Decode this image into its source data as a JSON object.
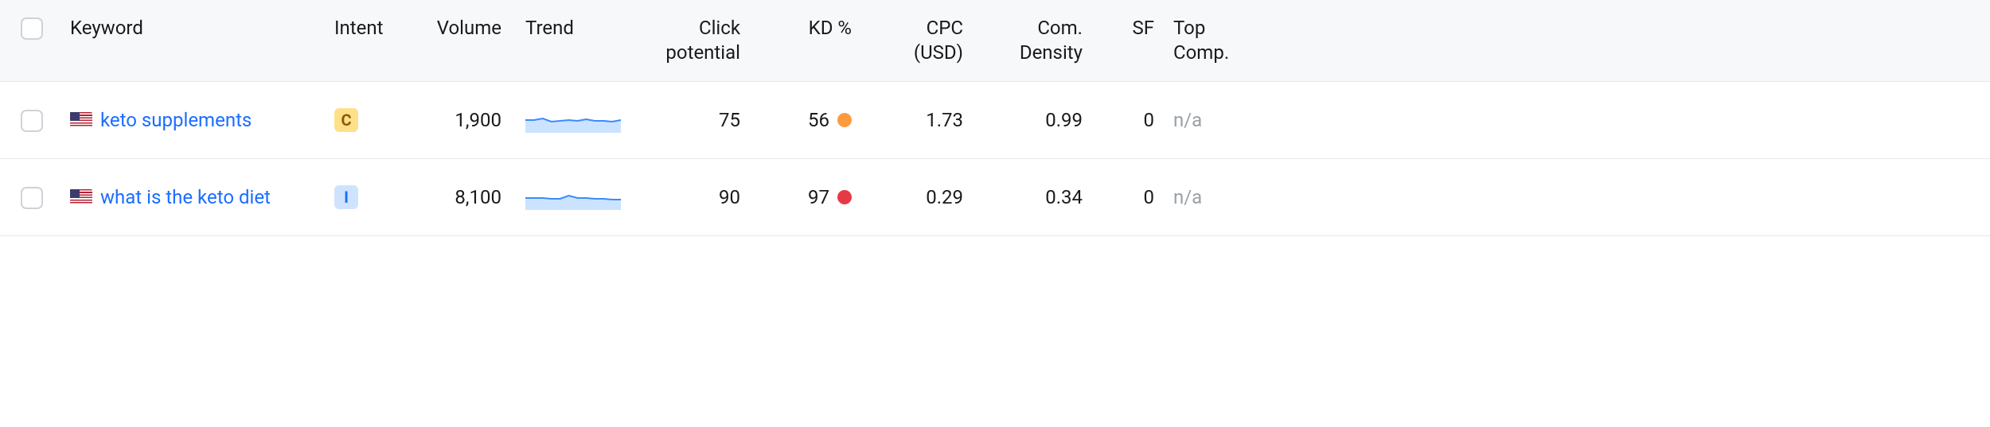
{
  "columns": {
    "keyword": "Keyword",
    "intent": "Intent",
    "volume": "Volume",
    "trend": "Trend",
    "click_potential_l1": "Click",
    "click_potential_l2": "potential",
    "kd": "KD %",
    "cpc_l1": "CPC",
    "cpc_l2": "(USD)",
    "density_l1": "Com.",
    "density_l2": "Density",
    "sf": "SF",
    "top_l1": "Top",
    "top_l2": "Comp."
  },
  "colors": {
    "link": "#1a6dff",
    "kd_orange": "#ff9b3f",
    "kd_red": "#e63946"
  },
  "rows": [
    {
      "country": "US",
      "keyword": "keto supplements",
      "intent_code": "C",
      "volume": "1,900",
      "trend_y": [
        16,
        16,
        18,
        14,
        15,
        16,
        15,
        17,
        15,
        15,
        14,
        16
      ],
      "click_potential": "75",
      "kd": "56",
      "kd_color": "#ff9b3f",
      "cpc": "1.73",
      "density": "0.99",
      "sf": "0",
      "top_comp": "n/a"
    },
    {
      "country": "US",
      "keyword": "what is the keto diet",
      "intent_code": "I",
      "volume": "8,100",
      "trend_y": [
        15,
        15,
        15,
        14,
        14,
        18,
        15,
        15,
        14,
        14,
        13,
        13
      ],
      "click_potential": "90",
      "kd": "97",
      "kd_color": "#e63946",
      "cpc": "0.29",
      "density": "0.34",
      "sf": "0",
      "top_comp": "n/a"
    }
  ],
  "chart_data": [
    {
      "type": "line",
      "title": "Trend — keto supplements",
      "y": [
        16,
        16,
        18,
        14,
        15,
        16,
        15,
        17,
        15,
        15,
        14,
        16
      ],
      "ylim": [
        0,
        32
      ],
      "xlabel": "",
      "ylabel": ""
    },
    {
      "type": "line",
      "title": "Trend — what is the keto diet",
      "y": [
        15,
        15,
        15,
        14,
        14,
        18,
        15,
        15,
        14,
        14,
        13,
        13
      ],
      "ylim": [
        0,
        32
      ],
      "xlabel": "",
      "ylabel": ""
    }
  ]
}
